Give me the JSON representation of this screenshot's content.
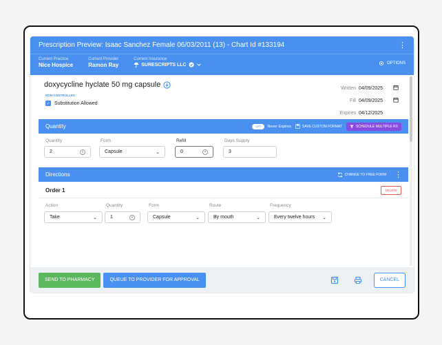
{
  "header": {
    "title": "Prescription Preview: Isaac Sanchez Female 06/03/2011 (13) - Chart Id #133194"
  },
  "subheader": {
    "practice_label": "Current Practice",
    "practice_value": "Nice Hospice",
    "provider_label": "Current Provider",
    "provider_value": "Ramon Ray",
    "insurance_label": "Current Insurance",
    "insurance_value": "SURESCRIPTS LLC",
    "options_label": "OPTIONS"
  },
  "drug": {
    "name": "doxycycline hyclate 50 mg capsule",
    "control": "NON-CONTROLLED",
    "substitution_label": "Substitution Allowed"
  },
  "dates": {
    "written_label": "Written",
    "written_value": "04/09/2025",
    "fill_label": "Fill",
    "fill_value": "04/09/2025",
    "expires_label": "Expires",
    "expires_value": "04/12/2025"
  },
  "quantity_band": {
    "title": "Quantity",
    "toggle_label": "OFF",
    "never_expires": "Never Expires",
    "save_custom": "SAVE CUSTOM FORMAT",
    "schedule": "SCHEDULE MULTIPLE RX"
  },
  "quantity_fields": {
    "quantity_label": "Quantity",
    "quantity_value": "2",
    "form_label": "Form",
    "form_value": "Capsule",
    "refill_label": "Refill",
    "refill_value": "0",
    "days_label": "Days Supply",
    "days_value": "3"
  },
  "directions_band": {
    "title": "Directions",
    "change_label": "CHANGE TO FREE FORM"
  },
  "order": {
    "title": "Order 1",
    "delete_label": "DELETE",
    "action_label": "Action",
    "action_value": "Take",
    "quantity_label": "Quantity",
    "quantity_value": "1",
    "form_label": "Form",
    "form_value": "Capsule",
    "route_label": "Route",
    "route_value": "By mouth",
    "frequency_label": "Frequency",
    "frequency_value": "Every twelve hours"
  },
  "footer": {
    "send_label": "SEND TO PHARMACY",
    "queue_label": "QUEUE TO PROVIDER FOR APPROVAL",
    "cancel_label": "CANCEL"
  },
  "colors": {
    "primary": "#4a90f0",
    "green": "#5cb85c",
    "purple": "#8a4ce0",
    "danger": "#e05a4a"
  }
}
